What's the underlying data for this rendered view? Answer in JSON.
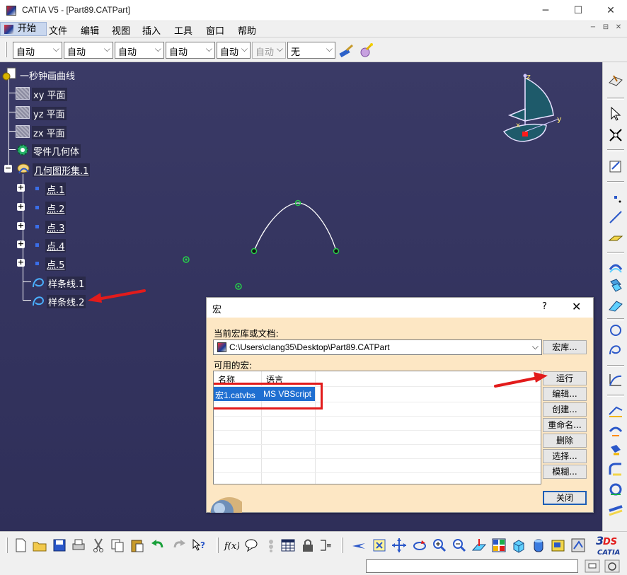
{
  "window": {
    "title": "CATIA V5 - [Part89.CATPart]",
    "minimize_glyph": "─",
    "maximize_glyph": "☐",
    "close_glyph": "✕"
  },
  "menu": {
    "start": "开始",
    "items": [
      "文件",
      "编辑",
      "视图",
      "插入",
      "工具",
      "窗口",
      "帮助"
    ],
    "mdi": [
      "−",
      "⊟",
      "✕"
    ]
  },
  "properties_toolbar": {
    "combos": [
      "自动",
      "自动",
      "自动",
      "自动",
      "自动",
      "自动",
      "无"
    ]
  },
  "tree": {
    "root": "一秒钟画曲线",
    "planes": [
      "xy 平面",
      "yz 平面",
      "zx 平面"
    ],
    "body": "零件几何体",
    "geoset": "几何图形集.1",
    "points": [
      "点.1",
      "点.2",
      "点.3",
      "点.4",
      "点.5"
    ],
    "splines": [
      "样条线.1",
      "样条线.2"
    ]
  },
  "compass": {
    "z": "z",
    "y": "y",
    "x": "x"
  },
  "macro_dialog": {
    "title": "宏",
    "help": "?",
    "close_x": "✕",
    "library_label": "当前宏库或文档:",
    "library_value": "C:\\Users\\clang35\\Desktop\\Part89.CATPart",
    "available_label": "可用的宏:",
    "columns": [
      "名称",
      "语言"
    ],
    "rows": [
      {
        "name": "宏1.catvbs",
        "language": "MS VBScript"
      }
    ],
    "buttons": {
      "library": "宏库...",
      "run": "运行",
      "edit": "编辑...",
      "create": "创建...",
      "rename": "重命名...",
      "delete": "删除",
      "select": "选择...",
      "template": "模糊...",
      "close": "关闭"
    }
  },
  "colors": {
    "viewport_bg": "#34345f",
    "dialog_bg": "#fde7c4",
    "selection": "#1f6fd1",
    "annotation": "#e21b1b"
  }
}
